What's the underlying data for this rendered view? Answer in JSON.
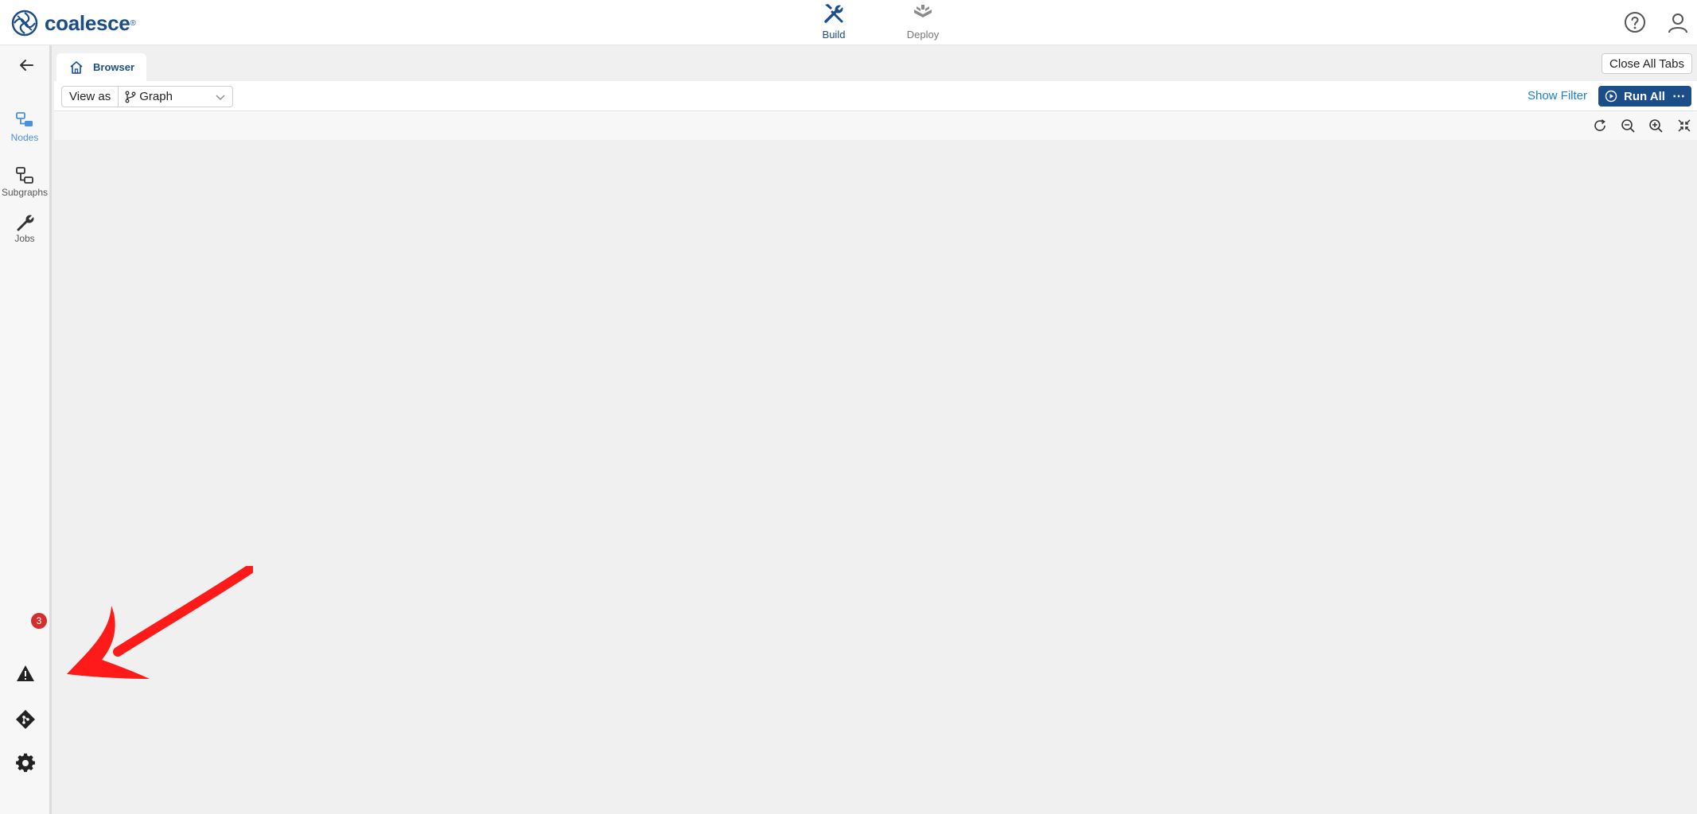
{
  "header": {
    "brand": "coalesce",
    "brand_mark": "®",
    "modes": [
      {
        "label": "Build",
        "icon": "wrench-screwdriver-icon",
        "active": true
      },
      {
        "label": "Deploy",
        "icon": "deploy-icon",
        "active": false
      }
    ],
    "icons": [
      "help-icon",
      "user-icon"
    ]
  },
  "sidebar": {
    "items": [
      {
        "label": "Nodes",
        "icon": "nodes-icon",
        "active": true
      },
      {
        "label": "Subgraphs",
        "icon": "subgraphs-icon",
        "active": false
      },
      {
        "label": "Jobs",
        "icon": "wrench-icon",
        "active": false
      }
    ],
    "bottom": {
      "warnings_count": "3"
    }
  },
  "tabs": {
    "items": [
      {
        "label": "Browser",
        "icon": "home-icon"
      }
    ],
    "close_all_label": "Close All Tabs"
  },
  "toolbar": {
    "view_as_label": "View as",
    "view_as_value": "Graph",
    "show_filter_label": "Show Filter",
    "run_all_label": "Run All"
  },
  "colors": {
    "accent": "#1b4d89",
    "link": "#1a7fd1",
    "badge": "#d32f2f",
    "annotation_arrow": "#ff1a1a"
  }
}
